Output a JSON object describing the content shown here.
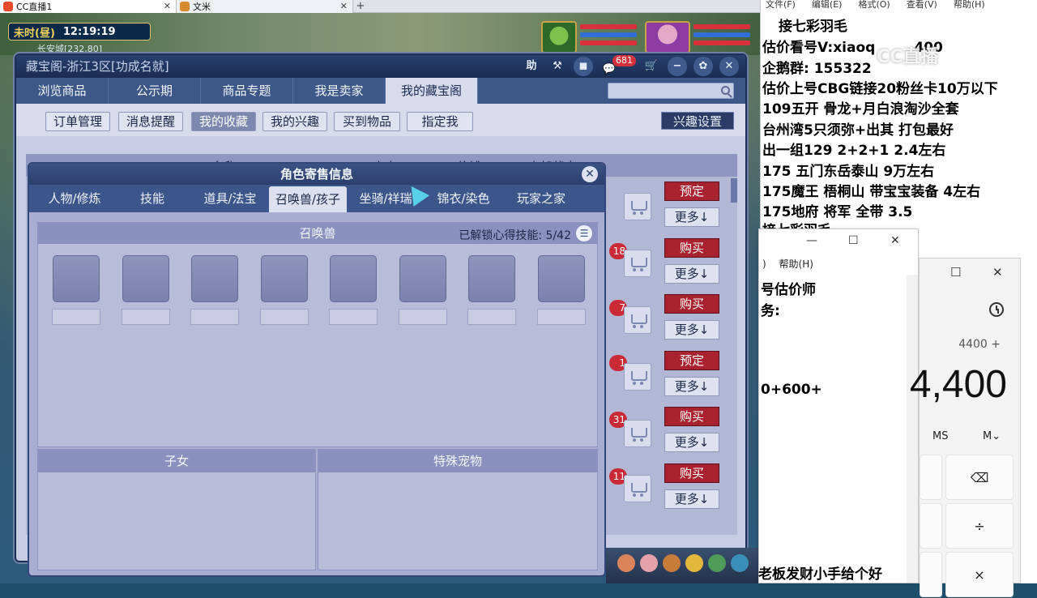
{
  "browser_tabs": [
    {
      "label": "CC直播1",
      "active": true
    },
    {
      "label": "文米",
      "active": false
    }
  ],
  "game": {
    "clock_period": "未时(昼)",
    "clock_time": "12:19:19",
    "location": "长安城[232,80]"
  },
  "panel": {
    "title": "藏宝阁-浙江3区[功成名就]",
    "toolbar": {
      "help": "助",
      "msg_count": "681"
    },
    "nav_tabs": [
      "浏览商品",
      "公示期",
      "商品专题",
      "我是卖家",
      "我的藏宝阁"
    ],
    "nav_active": "我的藏宝阁",
    "search_placeholder": "",
    "sub_buttons": [
      "订单管理",
      "消息提醒",
      "我的收藏",
      "我的兴趣",
      "买到物品",
      "指定我"
    ],
    "sub_active": "我的收藏",
    "interest_btn": "兴趣设置",
    "columns": [
      "名称",
      "亮点",
      "价钱",
      "上架状态"
    ],
    "rows": [
      {
        "badge": "",
        "action": "预定",
        "more": "更多↓"
      },
      {
        "badge": "18",
        "action": "购买",
        "more": "更多↓"
      },
      {
        "badge": "7",
        "action": "购买",
        "more": "更多↓"
      },
      {
        "badge": "1",
        "action": "预定",
        "more": "更多↓"
      },
      {
        "badge": "31",
        "action": "购买",
        "more": "更多↓"
      },
      {
        "badge": "11",
        "action": "购买",
        "more": "更多↓"
      }
    ]
  },
  "dialog": {
    "title": "角色寄售信息",
    "close": "✕",
    "tabs": [
      "人物/修炼",
      "技能",
      "道具/法宝",
      "召唤兽/孩子",
      "坐骑/祥瑞",
      "锦衣/染色",
      "玩家之家"
    ],
    "tab_active": "召唤兽/孩子",
    "pet_section_title": "召唤兽",
    "skills_label": "已解锁心得技能:",
    "skills_value": "5/42",
    "child_section_title": "子女",
    "special_pet_title": "特殊宠物"
  },
  "notepad": {
    "menu": [
      "文件(F)",
      "编辑(E)",
      "格式(O)",
      "查看(V)",
      "帮助(H)"
    ],
    "lines": [
      "接七彩羽毛",
      "估价看号V:xiaoq",
      "企鹅群: 155322",
      "估价上号CBG链接20粉丝卡10万以下",
      "109五开 骨龙+月白浪淘沙全套",
      "台州湾5只须弥+出其 打包最好",
      "出一组129 2+2+1    2.4左右",
      "175 五门东岳泰山  9万左右",
      "175魔王 梧桐山  带宝宝装备 4左右",
      "175地府 将军  全带 3.5",
      "    接七彩羽毛"
    ],
    "qq_tail": "400",
    "watermark": "CC直播"
  },
  "notepad2": {
    "menu": "帮助(H)",
    "menu_prefix": ")",
    "line1": "号估价师",
    "line2": "务:",
    "line3": "0+600+",
    "bottom": "老板发财小手给个好"
  },
  "calculator": {
    "expression": "4400 +",
    "display": "4,400",
    "mem_ms": "MS",
    "mem_mv": "M⌄",
    "key_backspace": "⌫",
    "key_divide": "÷",
    "key_multiply": "×"
  }
}
